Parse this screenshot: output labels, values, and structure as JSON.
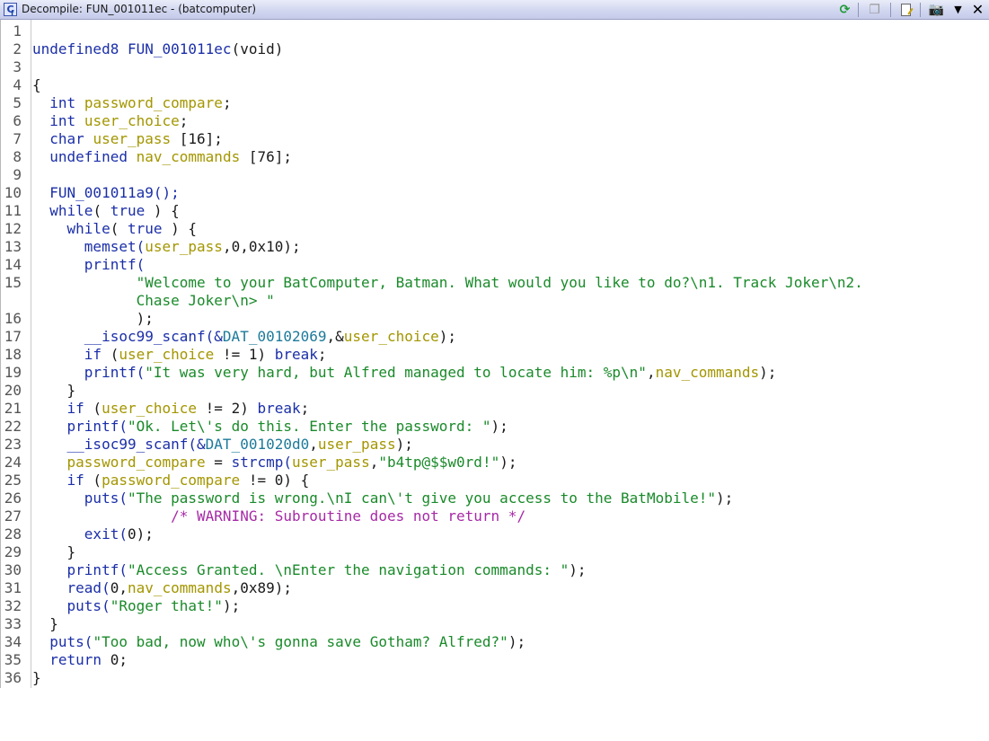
{
  "window": {
    "title": "Decompile: FUN_001011ec - (batcomputer)",
    "icon_label": "C",
    "toolbar": {
      "refresh_icon": "refresh-icon",
      "copy_icon": "copy-icon",
      "snapshot_icon": "edit-snapshot-icon",
      "camera_icon": "camera-icon",
      "menu_icon": "dropdown-menu-icon",
      "close_icon": "close-icon"
    }
  },
  "colors": {
    "keyword": "#1b2fa8",
    "variable": "#a39600",
    "string": "#1a8a2a",
    "comment": "#a62aa6",
    "global": "#1d7a9a"
  },
  "code": {
    "line_numbers": [
      "1",
      "2",
      "3",
      "4",
      "5",
      "6",
      "7",
      "8",
      "9",
      "10",
      "11",
      "12",
      "13",
      "14",
      "15",
      "16",
      "17",
      "18",
      "19",
      "20",
      "21",
      "22",
      "23",
      "24",
      "25",
      "26",
      "27",
      "28",
      "29",
      "30",
      "31",
      "32",
      "33",
      "34",
      "35",
      "36"
    ],
    "l2": {
      "type": "undefined8",
      "fn": "FUN_001011ec",
      "rest": "(void)"
    },
    "l4": "{",
    "l5": {
      "type": "int",
      "var": "password_compare",
      "end": ";"
    },
    "l6": {
      "type": "int",
      "var": "user_choice",
      "end": ";"
    },
    "l7": {
      "type": "char",
      "var": "user_pass",
      "end": " [16];"
    },
    "l8": {
      "type": "undefined",
      "var": "nav_commands",
      "end": " [76];"
    },
    "l10": "FUN_001011a9();",
    "l11": {
      "kw": "while",
      "open": "( ",
      "true": "true",
      "close": " ) {"
    },
    "l12": {
      "kw": "while",
      "open": "( ",
      "true": "true",
      "close": " ) {"
    },
    "l13": {
      "fn": "memset(",
      "var": "user_pass",
      "rest": ",0,0x10);"
    },
    "l14": "printf(",
    "l15a": "\"Welcome to your BatComputer, Batman. What would you like to do?\\n1. Track Joker\\n2.",
    "l15b": "Chase Joker\\n> \"",
    "l16": ");",
    "l17": {
      "fn": "__isoc99_scanf(&",
      "glob": "DAT_00102069",
      "mid": ",&",
      "var": "user_choice",
      "end": ");"
    },
    "l18": {
      "kw": "if",
      "open": " (",
      "var": "user_choice",
      "mid": " != 1) ",
      "brk": "break",
      "end": ";"
    },
    "l19": {
      "fn": "printf(",
      "str": "\"It was very hard, but Alfred managed to locate him: %p\\n\"",
      "mid": ",",
      "var": "nav_commands",
      "end": ");"
    },
    "l20": "}",
    "l21": {
      "kw": "if",
      "open": " (",
      "var": "user_choice",
      "mid": " != 2) ",
      "brk": "break",
      "end": ";"
    },
    "l22": {
      "fn": "printf(",
      "str": "\"Ok. Let\\'s do this. Enter the password: \"",
      "end": ");"
    },
    "l23": {
      "fn": "__isoc99_scanf(&",
      "glob": "DAT_001020d0",
      "mid": ",",
      "var": "user_pass",
      "end": ");"
    },
    "l24": {
      "var": "password_compare",
      "mid": " = ",
      "fn": "strcmp(",
      "var2": "user_pass",
      "comma": ",",
      "str": "\"b4tp@$$w0rd!\"",
      "end": ");"
    },
    "l25": {
      "kw": "if",
      "open": " (",
      "var": "password_compare",
      "mid": " != 0) {"
    },
    "l26": {
      "fn": "puts(",
      "str": "\"The password is wrong.\\nI can\\'t give you access to the BatMobile!\"",
      "end": ");"
    },
    "l27": "/* WARNING: Subroutine does not return */",
    "l28": {
      "fn": "exit(",
      "num": "0",
      "end": ");"
    },
    "l29": "}",
    "l30": {
      "fn": "printf(",
      "str": "\"Access Granted. \\nEnter the navigation commands: \"",
      "end": ");"
    },
    "l31": {
      "fn": "read(",
      "num": "0",
      "comma": ",",
      "var": "nav_commands",
      "end": ",0x89);"
    },
    "l32": {
      "fn": "puts(",
      "str": "\"Roger that!\"",
      "end": ");"
    },
    "l33": "}",
    "l34": {
      "fn": "puts(",
      "str": "\"Too bad, now who\\'s gonna save Gotham? Alfred?\"",
      "end": ");"
    },
    "l35": {
      "kw": "return",
      "rest": " 0;"
    },
    "l36": "}"
  }
}
